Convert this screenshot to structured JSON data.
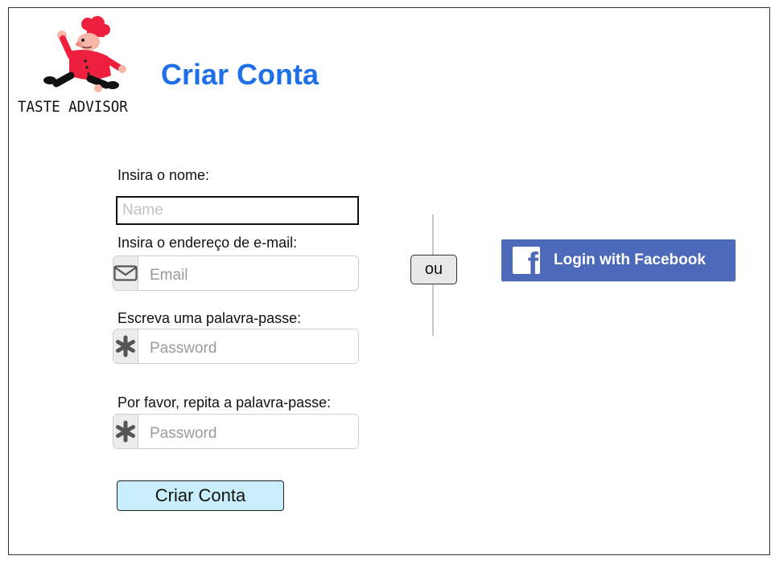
{
  "brand": {
    "name": "TASTE ADVISOR"
  },
  "page": {
    "title": "Criar Conta"
  },
  "form": {
    "name_label": "Insira o nome:",
    "name_placeholder": "Name",
    "email_label": "Insira o endereço de e-mail:",
    "email_placeholder": "Email",
    "email_icon": "envelope-icon",
    "password_label": "Escreva uma palavra-passe:",
    "password_placeholder": "Password",
    "password_icon": "asterisk-icon",
    "repeat_label": "Por favor, repita a palavra-passe:",
    "repeat_placeholder": "Password",
    "submit_label": "Criar Conta"
  },
  "divider": {
    "label": "ou"
  },
  "social": {
    "facebook_label": "Login with Facebook",
    "facebook_icon": "facebook-f-icon"
  },
  "colors": {
    "title": "#1f6fe8",
    "facebook": "#4c69ba",
    "submit_bg": "#c8eefb",
    "chef_jacket": "#ee1f3f"
  }
}
